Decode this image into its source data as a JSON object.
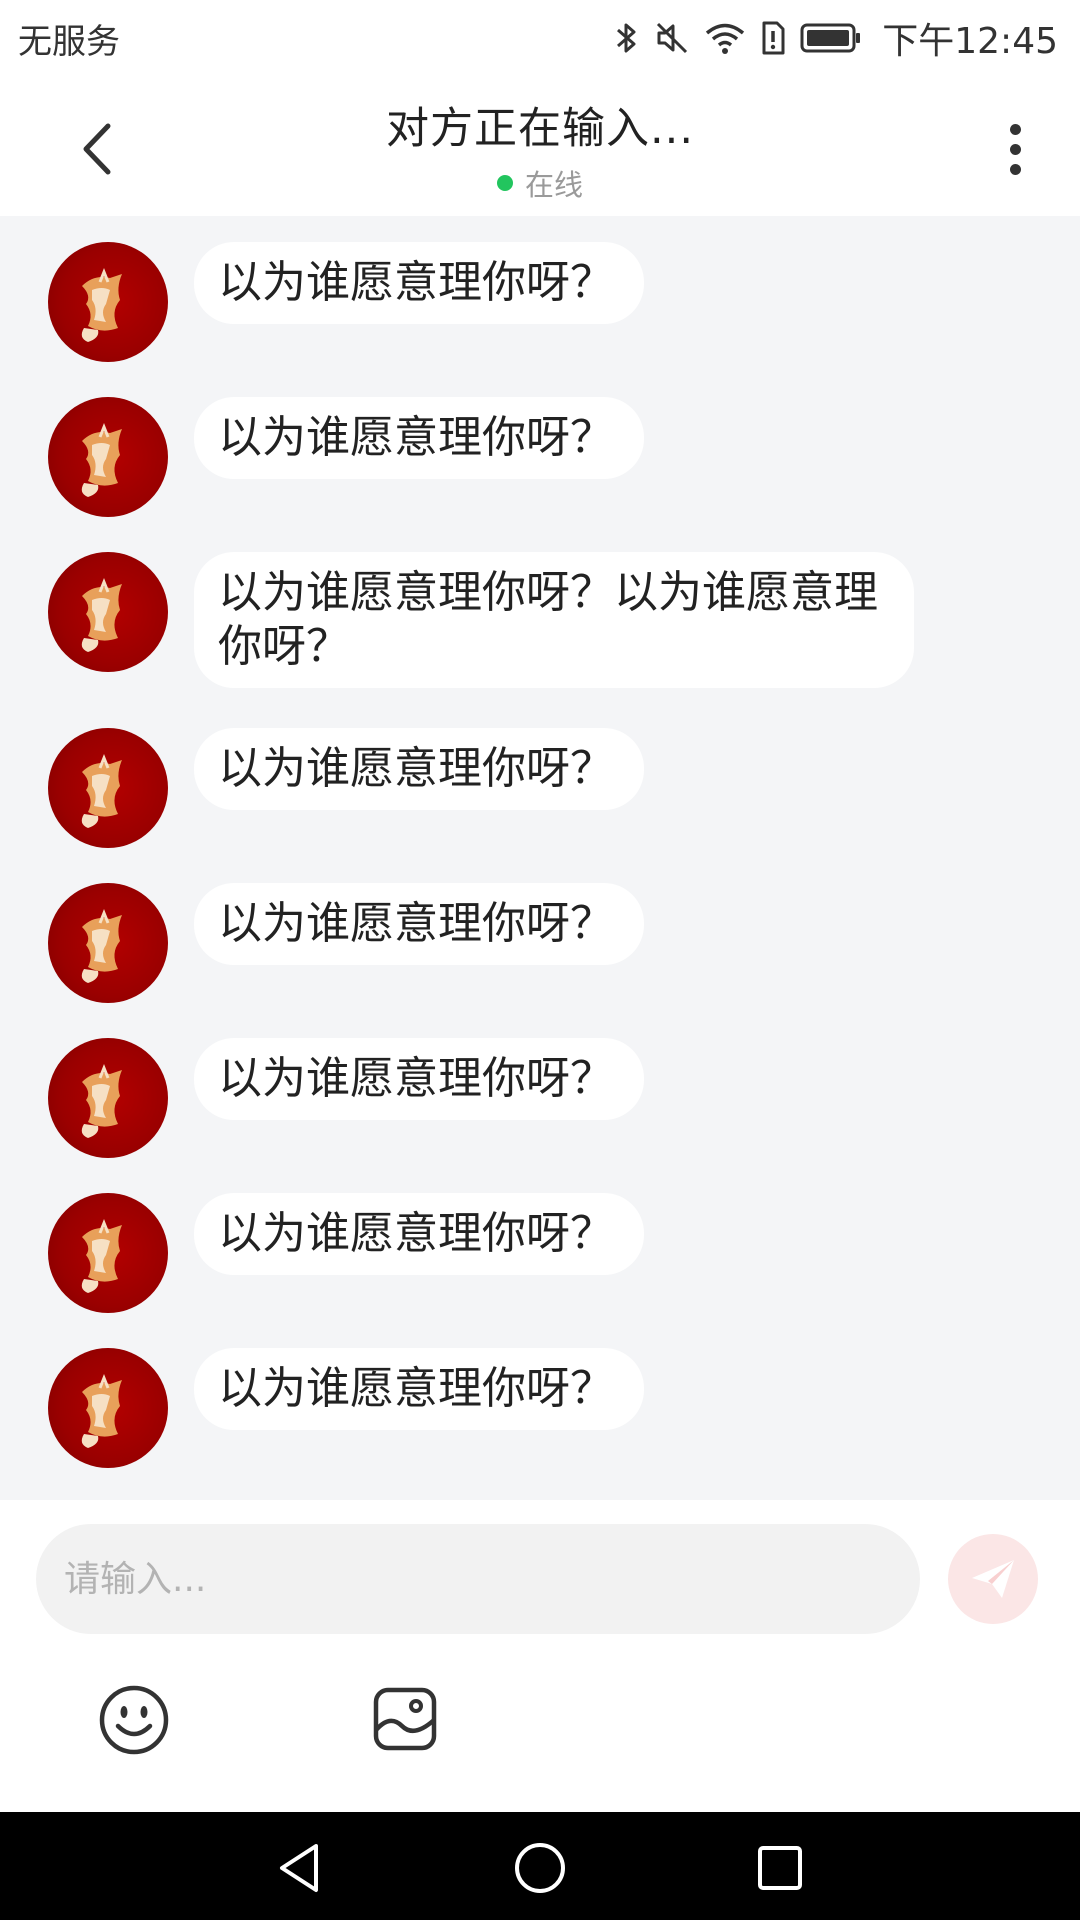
{
  "status_bar": {
    "carrier": "无服务",
    "time": "下午12:45",
    "icons": [
      "bluetooth-icon",
      "mute-icon",
      "wifi-icon",
      "sim-alert-icon",
      "battery-icon"
    ]
  },
  "header": {
    "title": "对方正在输入...",
    "status": "在线",
    "status_color": "#22c55e"
  },
  "messages": [
    {
      "text": "以为谁愿意理你呀？"
    },
    {
      "text": "以为谁愿意理你呀？"
    },
    {
      "text": "以为谁愿意理你呀？以为谁愿意理你呀？"
    },
    {
      "text": "以为谁愿意理你呀？"
    },
    {
      "text": "以为谁愿意理你呀？"
    },
    {
      "text": "以为谁愿意理你呀？"
    },
    {
      "text": "以为谁愿意理你呀？"
    },
    {
      "text": "以为谁愿意理你呀？"
    }
  ],
  "composer": {
    "value": "",
    "placeholder": "请输入...",
    "send_icon": "send-icon",
    "send_color": "#f15b5b",
    "tools": [
      "emoji-icon",
      "image-icon"
    ]
  },
  "nav_bar": {
    "buttons": [
      "back-triangle-icon",
      "home-circle-icon",
      "recents-square-icon"
    ]
  }
}
